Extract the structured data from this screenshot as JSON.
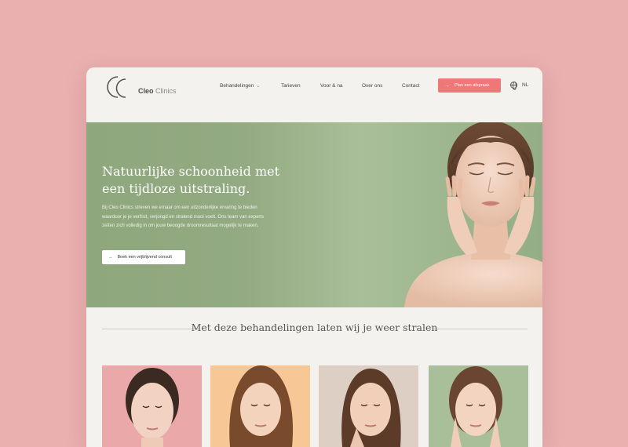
{
  "brand": {
    "name_bold": "Cleo",
    "name_light": "Clinics"
  },
  "nav": {
    "items": [
      {
        "label": "Behandelingen"
      },
      {
        "label": "Tarieven"
      },
      {
        "label": "Voor & na"
      },
      {
        "label": "Over ons"
      },
      {
        "label": "Contact"
      }
    ],
    "cta_label": "Plan een afspraak",
    "language": "NL"
  },
  "hero": {
    "title": "Natuurlijke schoonheid met een tijdloze uitstraling.",
    "text": "Bij Cleo Clinics streven we ernaar om een uitzonderlijke ervaring te bieden waardoor je je verfrist, verjongd en stralend mooi voelt. Ons team van experts zetten zich volledig in om jouw beoogde droomresultaat mogelijk te maken.",
    "button_label": "Boek een vrijblijvend consult"
  },
  "treatments": {
    "title": "Met deze behandelingen laten wij je weer stralen",
    "cards": [
      {
        "bg": "#eba8a8"
      },
      {
        "bg": "#f7c896"
      },
      {
        "bg": "#ddcfc4"
      },
      {
        "bg": "#a9bf9a"
      }
    ]
  },
  "colors": {
    "accent": "#ee7777",
    "hero_green": "#93aa82",
    "page_bg": "#eab0b0"
  }
}
